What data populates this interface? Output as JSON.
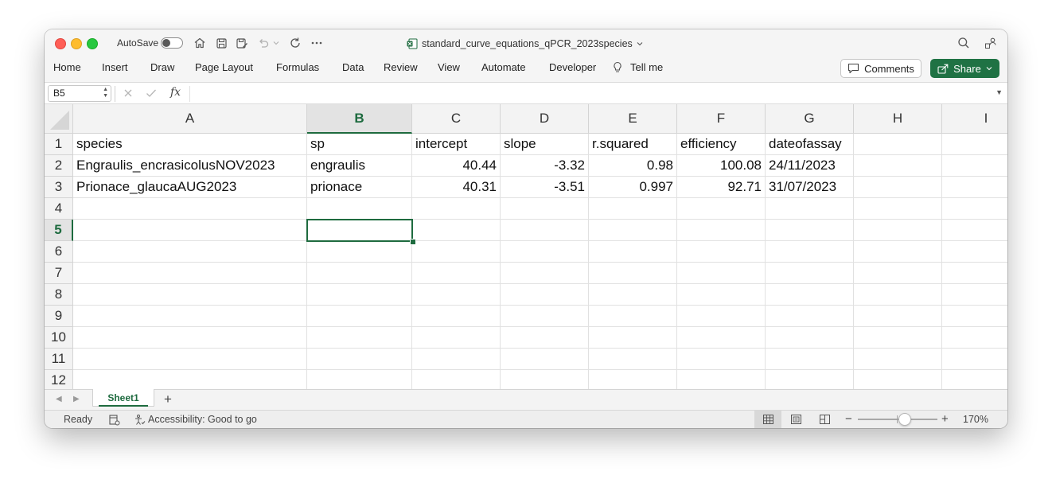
{
  "titlebar": {
    "autosave_label": "AutoSave",
    "autosave_on": false,
    "document_title": "standard_curve_equations_qPCR_2023species"
  },
  "ribbon": {
    "tabs": [
      "Home",
      "Insert",
      "Draw",
      "Page Layout",
      "Formulas",
      "Data",
      "Review",
      "View",
      "Automate",
      "Developer"
    ],
    "tell_me": "Tell me",
    "comments_label": "Comments",
    "share_label": "Share"
  },
  "formula_bar": {
    "name_box": "B5",
    "fx_label": "fx",
    "formula": ""
  },
  "grid": {
    "columns": [
      "A",
      "B",
      "C",
      "D",
      "E",
      "F",
      "G",
      "H",
      "I"
    ],
    "rows": [
      "1",
      "2",
      "3",
      "4",
      "5",
      "6",
      "7",
      "8",
      "9",
      "10",
      "11",
      "12"
    ],
    "selected_cell": "B5",
    "cells": [
      [
        "species",
        "sp",
        "intercept",
        "slope",
        "r.squared",
        "efficiency",
        "dateofassay",
        "",
        ""
      ],
      [
        "Engraulis_encrasicolusNOV2023",
        "engraulis",
        "40.44",
        "-3.32",
        "0.98",
        "100.08",
        "24/11/2023",
        "",
        ""
      ],
      [
        "Prionace_glaucaAUG2023",
        "prionace",
        "40.31",
        "-3.51",
        "0.997",
        "92.71",
        "31/07/2023",
        "",
        ""
      ]
    ]
  },
  "sheets": {
    "tabs": [
      "Sheet1"
    ],
    "add_label": "+"
  },
  "status_bar": {
    "ready": "Ready",
    "accessibility": "Accessibility: Good to go",
    "zoom_level": "170%",
    "zoom_minus": "−",
    "zoom_plus": "+"
  },
  "colors": {
    "accent_green": "#1e6b3f",
    "share_button": "#1f7244"
  }
}
